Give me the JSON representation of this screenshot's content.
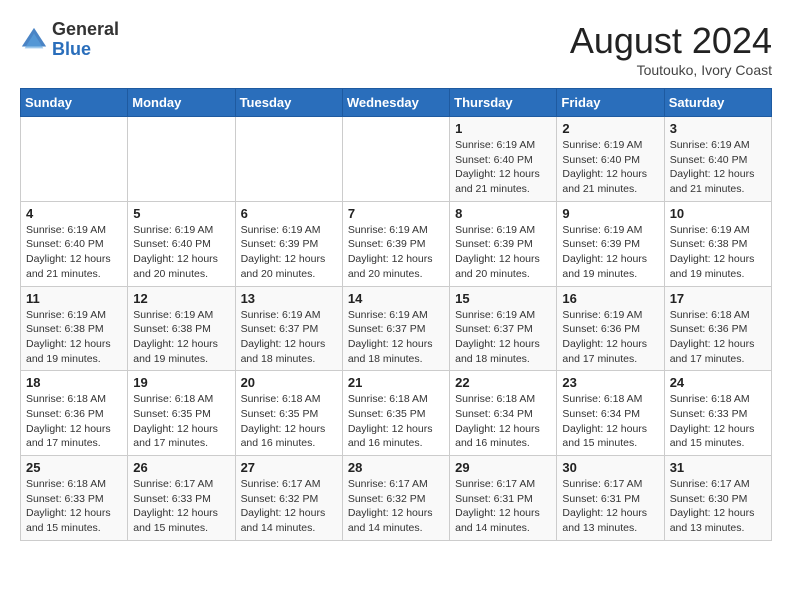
{
  "header": {
    "logo_general": "General",
    "logo_blue": "Blue",
    "month_year": "August 2024",
    "location": "Toutouko, Ivory Coast"
  },
  "weekdays": [
    "Sunday",
    "Monday",
    "Tuesday",
    "Wednesday",
    "Thursday",
    "Friday",
    "Saturday"
  ],
  "weeks": [
    [
      {
        "day": "",
        "info": ""
      },
      {
        "day": "",
        "info": ""
      },
      {
        "day": "",
        "info": ""
      },
      {
        "day": "",
        "info": ""
      },
      {
        "day": "1",
        "info": "Sunrise: 6:19 AM\nSunset: 6:40 PM\nDaylight: 12 hours and 21 minutes."
      },
      {
        "day": "2",
        "info": "Sunrise: 6:19 AM\nSunset: 6:40 PM\nDaylight: 12 hours and 21 minutes."
      },
      {
        "day": "3",
        "info": "Sunrise: 6:19 AM\nSunset: 6:40 PM\nDaylight: 12 hours and 21 minutes."
      }
    ],
    [
      {
        "day": "4",
        "info": "Sunrise: 6:19 AM\nSunset: 6:40 PM\nDaylight: 12 hours and 21 minutes."
      },
      {
        "day": "5",
        "info": "Sunrise: 6:19 AM\nSunset: 6:40 PM\nDaylight: 12 hours and 20 minutes."
      },
      {
        "day": "6",
        "info": "Sunrise: 6:19 AM\nSunset: 6:39 PM\nDaylight: 12 hours and 20 minutes."
      },
      {
        "day": "7",
        "info": "Sunrise: 6:19 AM\nSunset: 6:39 PM\nDaylight: 12 hours and 20 minutes."
      },
      {
        "day": "8",
        "info": "Sunrise: 6:19 AM\nSunset: 6:39 PM\nDaylight: 12 hours and 20 minutes."
      },
      {
        "day": "9",
        "info": "Sunrise: 6:19 AM\nSunset: 6:39 PM\nDaylight: 12 hours and 19 minutes."
      },
      {
        "day": "10",
        "info": "Sunrise: 6:19 AM\nSunset: 6:38 PM\nDaylight: 12 hours and 19 minutes."
      }
    ],
    [
      {
        "day": "11",
        "info": "Sunrise: 6:19 AM\nSunset: 6:38 PM\nDaylight: 12 hours and 19 minutes."
      },
      {
        "day": "12",
        "info": "Sunrise: 6:19 AM\nSunset: 6:38 PM\nDaylight: 12 hours and 19 minutes."
      },
      {
        "day": "13",
        "info": "Sunrise: 6:19 AM\nSunset: 6:37 PM\nDaylight: 12 hours and 18 minutes."
      },
      {
        "day": "14",
        "info": "Sunrise: 6:19 AM\nSunset: 6:37 PM\nDaylight: 12 hours and 18 minutes."
      },
      {
        "day": "15",
        "info": "Sunrise: 6:19 AM\nSunset: 6:37 PM\nDaylight: 12 hours and 18 minutes."
      },
      {
        "day": "16",
        "info": "Sunrise: 6:19 AM\nSunset: 6:36 PM\nDaylight: 12 hours and 17 minutes."
      },
      {
        "day": "17",
        "info": "Sunrise: 6:18 AM\nSunset: 6:36 PM\nDaylight: 12 hours and 17 minutes."
      }
    ],
    [
      {
        "day": "18",
        "info": "Sunrise: 6:18 AM\nSunset: 6:36 PM\nDaylight: 12 hours and 17 minutes."
      },
      {
        "day": "19",
        "info": "Sunrise: 6:18 AM\nSunset: 6:35 PM\nDaylight: 12 hours and 17 minutes."
      },
      {
        "day": "20",
        "info": "Sunrise: 6:18 AM\nSunset: 6:35 PM\nDaylight: 12 hours and 16 minutes."
      },
      {
        "day": "21",
        "info": "Sunrise: 6:18 AM\nSunset: 6:35 PM\nDaylight: 12 hours and 16 minutes."
      },
      {
        "day": "22",
        "info": "Sunrise: 6:18 AM\nSunset: 6:34 PM\nDaylight: 12 hours and 16 minutes."
      },
      {
        "day": "23",
        "info": "Sunrise: 6:18 AM\nSunset: 6:34 PM\nDaylight: 12 hours and 15 minutes."
      },
      {
        "day": "24",
        "info": "Sunrise: 6:18 AM\nSunset: 6:33 PM\nDaylight: 12 hours and 15 minutes."
      }
    ],
    [
      {
        "day": "25",
        "info": "Sunrise: 6:18 AM\nSunset: 6:33 PM\nDaylight: 12 hours and 15 minutes."
      },
      {
        "day": "26",
        "info": "Sunrise: 6:17 AM\nSunset: 6:33 PM\nDaylight: 12 hours and 15 minutes."
      },
      {
        "day": "27",
        "info": "Sunrise: 6:17 AM\nSunset: 6:32 PM\nDaylight: 12 hours and 14 minutes."
      },
      {
        "day": "28",
        "info": "Sunrise: 6:17 AM\nSunset: 6:32 PM\nDaylight: 12 hours and 14 minutes."
      },
      {
        "day": "29",
        "info": "Sunrise: 6:17 AM\nSunset: 6:31 PM\nDaylight: 12 hours and 14 minutes."
      },
      {
        "day": "30",
        "info": "Sunrise: 6:17 AM\nSunset: 6:31 PM\nDaylight: 12 hours and 13 minutes."
      },
      {
        "day": "31",
        "info": "Sunrise: 6:17 AM\nSunset: 6:30 PM\nDaylight: 12 hours and 13 minutes."
      }
    ]
  ]
}
